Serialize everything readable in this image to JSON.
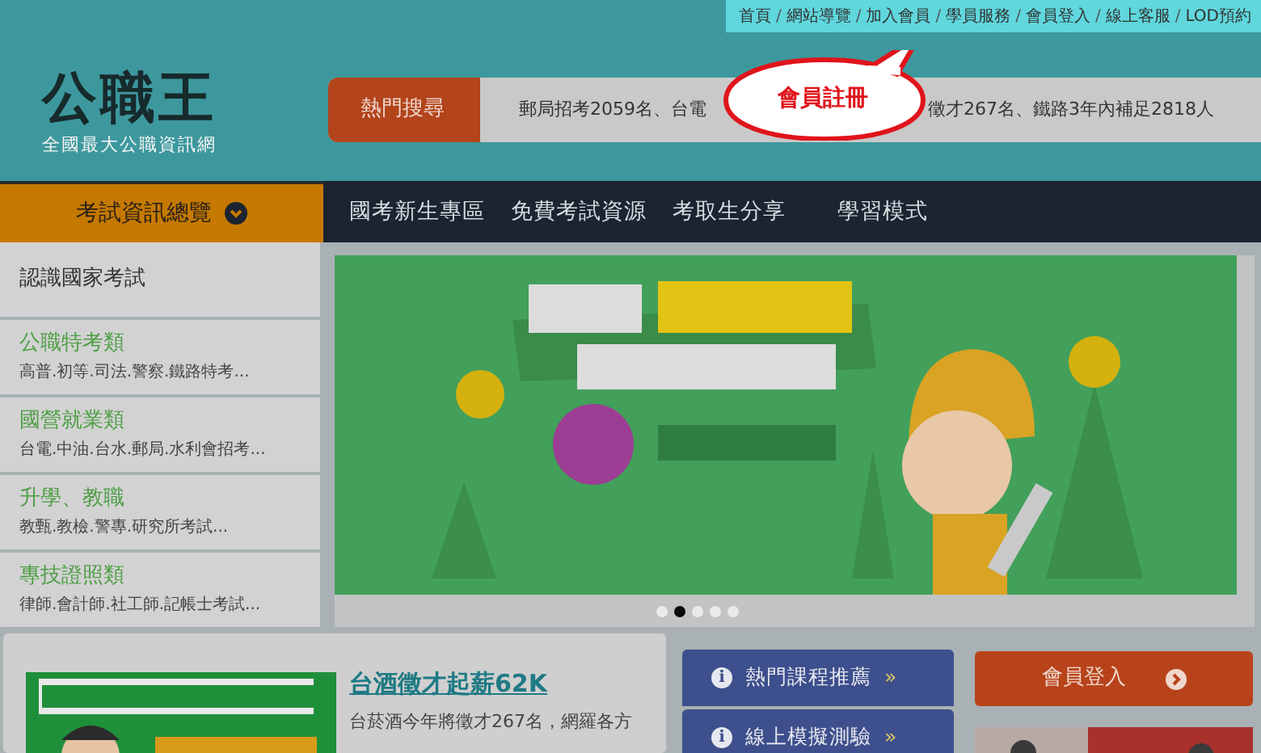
{
  "top_links": {
    "separator": "/",
    "items": [
      "首頁",
      "網站導覽",
      "加入會員",
      "學員服務",
      "會員登入",
      "線上客服",
      "LOD預約"
    ]
  },
  "logo": {
    "name": "公職王",
    "tagline": "全國最大公職資訊網"
  },
  "hot_search": {
    "label": "熱門搜尋",
    "text_before": "郵局招考2059名、台電",
    "text_after": "徵才267名、鐵路3年內補足2818人"
  },
  "callout": {
    "text": "會員註冊"
  },
  "nav": {
    "menu_button": "考試資訊總覽",
    "items": [
      "國考新生專區",
      "免費考試資源",
      "考取生分享",
      "學習模式"
    ]
  },
  "sidebar": {
    "items": [
      {
        "kind": "header",
        "title": "認識國家考試"
      },
      {
        "kind": "category",
        "title": "公職特考類",
        "subtitle": "高普.初等.司法.警察.鐵路特考..."
      },
      {
        "kind": "category",
        "title": "國營就業類",
        "subtitle": "台電.中油.台水.郵局.水利會招考..."
      },
      {
        "kind": "category",
        "title": "升學、教職",
        "subtitle": "教甄.教檢.警專.研究所考試..."
      },
      {
        "kind": "category",
        "title": "專技證照類",
        "subtitle": "律師.會計師.社工師.記帳士考試..."
      }
    ]
  },
  "banner": {
    "kind": "picture",
    "slides": [
      {
        "selected": false
      },
      {
        "selected": true
      },
      {
        "selected": false
      },
      {
        "selected": false
      },
      {
        "selected": false
      }
    ]
  },
  "news": {
    "title": "台酒徵才起薪62K",
    "body": "台菸酒今年將徵才267名，網羅各方"
  },
  "quick_links": [
    {
      "icon": "i",
      "label": "熱門課程推薦",
      "arrow": "»"
    },
    {
      "icon": "i",
      "label": "線上模擬測驗",
      "arrow": "»"
    }
  ],
  "login_button": {
    "label": "會員登入"
  }
}
